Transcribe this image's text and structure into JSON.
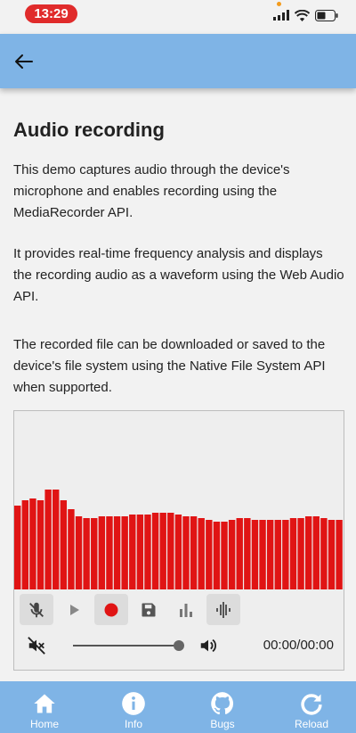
{
  "status": {
    "time": "13:29"
  },
  "page": {
    "title": "Audio recording",
    "paragraphs": [
      "This demo captures audio through the device's microphone and enables recording using the MediaRecorder API.",
      "It provides real-time frequency analysis and displays the recording audio as a waveform using the Web Audio API.",
      "The recorded file can be downloaded or saved to the device's file system using the Native File System API when supported."
    ]
  },
  "recorder": {
    "bar_color": "#e01414",
    "bar_levels": [
      0.47,
      0.5,
      0.51,
      0.5,
      0.56,
      0.56,
      0.5,
      0.45,
      0.41,
      0.4,
      0.4,
      0.41,
      0.41,
      0.41,
      0.41,
      0.42,
      0.42,
      0.42,
      0.43,
      0.43,
      0.43,
      0.42,
      0.41,
      0.41,
      0.4,
      0.39,
      0.38,
      0.38,
      0.39,
      0.4,
      0.4,
      0.39,
      0.39,
      0.39,
      0.39,
      0.39,
      0.4,
      0.4,
      0.41,
      0.41,
      0.4,
      0.39,
      0.39
    ],
    "time": "00:00/00:00",
    "volume_level": 0.97
  },
  "nav": {
    "items": [
      {
        "label": "Home",
        "icon": "home-icon"
      },
      {
        "label": "Info",
        "icon": "info-icon"
      },
      {
        "label": "Bugs",
        "icon": "github-icon"
      },
      {
        "label": "Reload",
        "icon": "reload-icon"
      }
    ]
  }
}
